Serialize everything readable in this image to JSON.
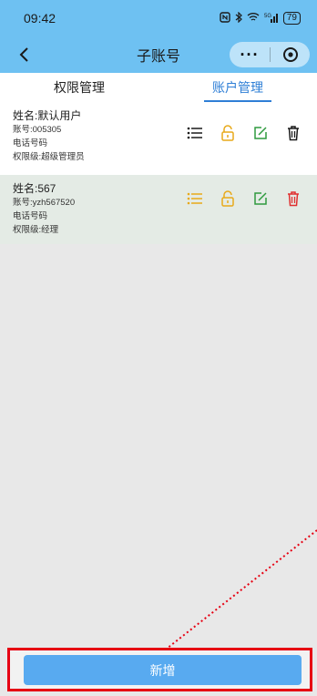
{
  "status_bar": {
    "time": "09:42",
    "battery": "79",
    "network": "5G"
  },
  "nav": {
    "title": "子账号",
    "more": "···"
  },
  "tabs": [
    {
      "label": "权限管理",
      "active": false
    },
    {
      "label": "账户管理",
      "active": true
    }
  ],
  "accounts": [
    {
      "name": "姓名:默认用户",
      "account": "账号:005305",
      "phone": "电话号码",
      "level": "权限级:超级管理员"
    },
    {
      "name": "姓名:567",
      "account": "账号:yzh567520",
      "phone": "电话号码",
      "level": "权限级:经理"
    }
  ],
  "add_button": {
    "label": "新增"
  },
  "colors": {
    "header": "#6ec1f2",
    "tab_active": "#2f7fd6",
    "lock": "#e8a91a",
    "edit": "#2e9a3e",
    "delete_red": "#e03030",
    "list_orange": "#e8a91a",
    "button": "#58aaf0",
    "annotation": "#e60012"
  },
  "icons": [
    "back-icon",
    "more-icon",
    "close-target-icon",
    "list-icon",
    "lock-icon",
    "edit-icon",
    "delete-icon"
  ]
}
